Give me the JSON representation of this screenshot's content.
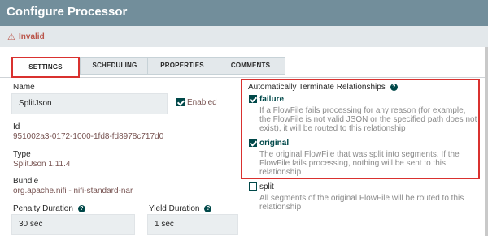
{
  "dialog": {
    "title": "Configure Processor"
  },
  "status": {
    "text": "Invalid"
  },
  "tabs": [
    {
      "label": "SETTINGS"
    },
    {
      "label": "SCHEDULING"
    },
    {
      "label": "PROPERTIES"
    },
    {
      "label": "COMMENTS"
    }
  ],
  "settings": {
    "name_label": "Name",
    "name_value": "SplitJson",
    "enabled_label": "Enabled",
    "id_label": "Id",
    "id_value": "951002a3-0172-1000-1fd8-fd8978c717d0",
    "type_label": "Type",
    "type_value": "SplitJson 1.11.4",
    "bundle_label": "Bundle",
    "bundle_value": "org.apache.nifi - nifi-standard-nar",
    "penalty_label": "Penalty Duration",
    "penalty_value": "30 sec",
    "yield_label": "Yield Duration",
    "yield_value": "1 sec"
  },
  "relationships": {
    "header": "Automatically Terminate Relationships",
    "items": [
      {
        "name": "failure",
        "checked": true,
        "description_lines": [
          "If a FlowFile fails processing for any reason (for example,",
          "the FlowFile is not valid JSON or the specified path does not",
          "exist), it will be routed to this relationship"
        ]
      },
      {
        "name": "original",
        "checked": true,
        "description_lines": [
          "The original FlowFile that was split into segments. If the",
          "FlowFile fails processing, nothing will be sent to this",
          "relationship"
        ]
      },
      {
        "name": "split",
        "checked": false,
        "description_lines": [
          "All segments of the original FlowFile will be routed to this",
          "relationship"
        ]
      }
    ]
  },
  "colors": {
    "titlebar": "#728e9b",
    "accent": "#004849",
    "value_text": "#775351",
    "invalid": "#ba554a",
    "highlight": "#d9312f"
  },
  "icons": {
    "warning": "warning-icon",
    "help": "help-icon",
    "checkbox": "checkbox-icon"
  }
}
